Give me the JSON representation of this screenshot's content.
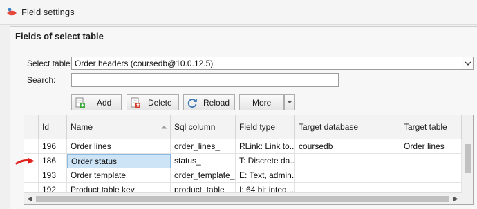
{
  "window": {
    "title": "Field settings"
  },
  "section": {
    "title": "Fields of select table"
  },
  "form": {
    "select_table_label": "Select table:",
    "select_table_value": "Order headers (coursedb@10.0.12.5)",
    "search_label": "Search:",
    "search_value": "",
    "search_placeholder": ""
  },
  "toolbar": {
    "add_label": "Add",
    "delete_label": "Delete",
    "reload_label": "Reload",
    "more_label": "More"
  },
  "grid": {
    "columns": [
      "",
      "Id",
      "Name",
      "Sql column",
      "Field type",
      "Target database",
      "Target table"
    ],
    "sorted_column": "Name",
    "rows": [
      {
        "id": "196",
        "name": "Order lines",
        "sql_column": "order_lines_",
        "field_type": "RLink: Link to...",
        "target_database": "coursedb",
        "target_table": "Order lines"
      },
      {
        "id": "186",
        "name": "Order status",
        "sql_column": "status_",
        "field_type": "T: Discrete da...",
        "target_database": "",
        "target_table": ""
      },
      {
        "id": "193",
        "name": "Order template",
        "sql_column": "order_template_",
        "field_type": "E: Text, admin...",
        "target_database": "",
        "target_table": ""
      },
      {
        "id": "192",
        "name": "Product table key",
        "sql_column": "product_table_",
        "field_type": "I: 64 bit integ...",
        "target_database": "",
        "target_table": ""
      }
    ],
    "selected_row_name": "Order status"
  },
  "colors": {
    "selection": "#cde4f7",
    "annotation_arrow": "#e0201c"
  }
}
